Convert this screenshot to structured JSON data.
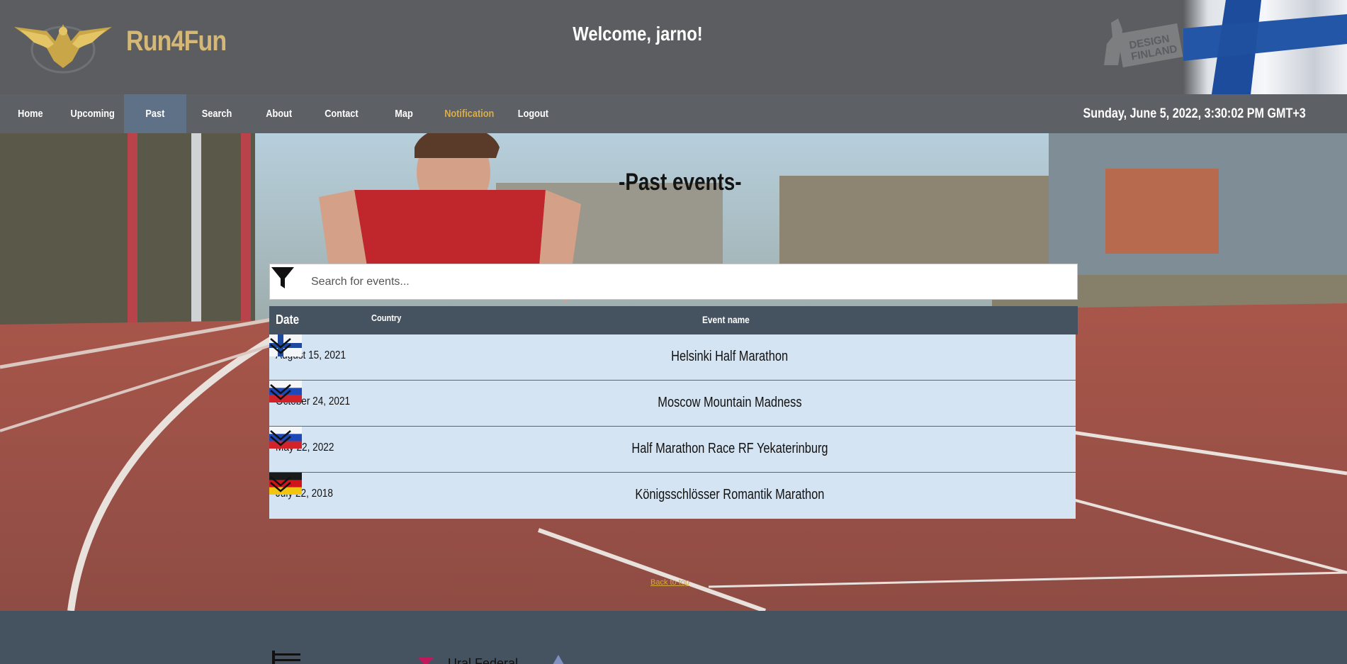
{
  "header": {
    "brand": "Run4Fun",
    "welcome": "Welcome, jarno!",
    "design_badge": "DESIGN FINLAND"
  },
  "nav": {
    "items": [
      {
        "label": "Home"
      },
      {
        "label": "Upcoming"
      },
      {
        "label": "Past"
      },
      {
        "label": "Search"
      },
      {
        "label": "About"
      },
      {
        "label": "Contact"
      },
      {
        "label": "Map"
      },
      {
        "label": "Notification"
      },
      {
        "label": "Logout"
      }
    ],
    "active": "Past",
    "clock": "Sunday, June 5, 2022, 3:30:02 PM GMT+3"
  },
  "main": {
    "title": "-Past events-",
    "search_placeholder": "Search for events...",
    "columns": {
      "date": "Date",
      "country": "Country",
      "event": "Event name"
    },
    "events": [
      {
        "date": "August 15, 2021",
        "country": "fi",
        "name": "Helsinki Half Marathon"
      },
      {
        "date": "October 24, 2021",
        "country": "ru",
        "name": "Moscow Mountain Madness"
      },
      {
        "date": "May 22, 2022",
        "country": "ru",
        "name": "Half Marathon Race RF Yekaterinburg"
      },
      {
        "date": "July 22, 2018",
        "country": "de",
        "name": "Königsschlösser Romantik Marathon"
      }
    ],
    "back_to_top": "Back to top"
  },
  "footer": {
    "partner_text": "Ural Federal"
  },
  "colors": {
    "accent_gold": "#d5b876",
    "nav_bg": "#5d6064",
    "nav_active": "#5e7187",
    "table_header": "#45525f",
    "row_bg": "#d5e4f3",
    "notification": "#d9ad4c"
  }
}
